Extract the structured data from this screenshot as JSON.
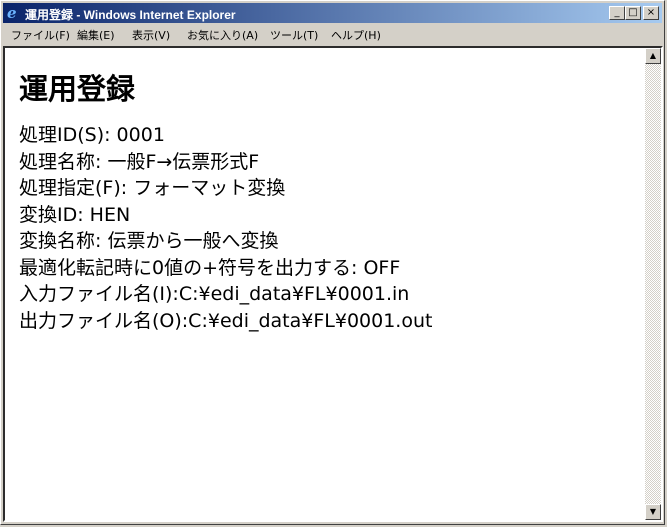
{
  "window": {
    "title": "運用登録 - Windows Internet Explorer",
    "controls": {
      "minimize": "_",
      "maximize": "□",
      "close": "×"
    }
  },
  "menu": {
    "items": [
      {
        "label": "ファイル(F)"
      },
      {
        "label": "編集(E)"
      },
      {
        "label": "表示(V)"
      },
      {
        "label": "お気に入り(A)"
      },
      {
        "label": "ツール(T)"
      },
      {
        "label": "ヘルプ(H)"
      }
    ]
  },
  "page": {
    "title": "運用登録",
    "lines": [
      "処理ID(S): 0001",
      "処理名称: 一般F→伝票形式F",
      "処理指定(F): フォーマット変換",
      "変換ID: HEN",
      "変換名称: 伝票から一般へ変換",
      "最適化転記時に0値の+符号を出力する: OFF",
      "入力ファイル名(I):C:¥edi_data¥FL¥0001.in",
      "出力ファイル名(O):C:¥edi_data¥FL¥0001.out"
    ]
  },
  "scrollbar": {
    "up": "▲",
    "down": "▼"
  }
}
